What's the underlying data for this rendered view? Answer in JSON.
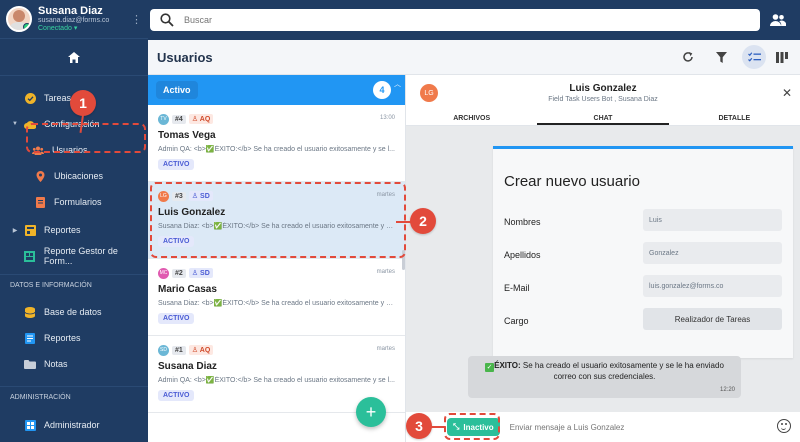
{
  "user": {
    "name": "Susana Diaz",
    "email": "susana.diaz@forms.co",
    "status": "Conectado"
  },
  "search": {
    "placeholder": "Buscar"
  },
  "sidebar": {
    "items": [
      {
        "label": "Tareas"
      },
      {
        "label": "Configuración"
      },
      {
        "label": "Usuarios"
      },
      {
        "label": "Ubicaciones"
      },
      {
        "label": "Formularios"
      },
      {
        "label": "Reportes"
      },
      {
        "label": "Reporte Gestor de Form..."
      }
    ],
    "section_data": "DATOS E INFORMACIÓN",
    "data_items": [
      {
        "label": "Base de datos"
      },
      {
        "label": "Reportes"
      },
      {
        "label": "Notas"
      }
    ],
    "section_admin": "ADMINISTRACIÓN",
    "admin_items": [
      {
        "label": "Administrador"
      }
    ]
  },
  "main": {
    "title": "Usuarios"
  },
  "list": {
    "status_label": "Activo",
    "count": "4",
    "cards": [
      {
        "initials": "TV",
        "number": "#4",
        "tag": "AQ",
        "time": "13:00",
        "name": "Tomas Vega",
        "snippet": "Admin QA: <b>✅ÉXITO:</b> Se ha creado el usuario exitosamente y se l...",
        "state": "ACTIVO"
      },
      {
        "initials": "LG",
        "number": "#3",
        "tag": "SD",
        "time": "martes",
        "name": "Luis Gonzalez",
        "snippet": "Susana Diaz: <b>✅ÉXITO:</b> Se ha creado el usuario exitosamente y se...",
        "state": "ACTIVO"
      },
      {
        "initials": "MC",
        "number": "#2",
        "tag": "SD",
        "time": "martes",
        "name": "Mario Casas",
        "snippet": "Susana Diaz: <b>✅ÉXITO:</b> Se ha creado el usuario exitosamente y se...",
        "state": "ACTIVO"
      },
      {
        "initials": "SD",
        "number": "#1",
        "tag": "AQ",
        "time": "martes",
        "name": "Susana Diaz",
        "snippet": "Admin QA: <b>✅ÉXITO:</b> Se ha creado el usuario exitosamente y se l...",
        "state": "ACTIVO"
      }
    ]
  },
  "chat": {
    "avatar_initials": "LG",
    "name": "Luis Gonzalez",
    "subtitle": "Field Task Users Bot , Susana Diaz",
    "tabs": [
      "ARCHIVOS",
      "CHAT",
      "DETALLE"
    ],
    "form": {
      "title": "Crear nuevo usuario",
      "fields": [
        {
          "label": "Nombres",
          "value": "Luis"
        },
        {
          "label": "Apellidos",
          "value": "Gonzalez"
        },
        {
          "label": "E-Mail",
          "value": "luis.gonzalez@forms.co"
        },
        {
          "label": "Cargo",
          "value": "Realizador de Tareas"
        }
      ]
    },
    "message": {
      "bold": "ÉXITO:",
      "text": "Se ha creado el usuario exitosamente y se le ha enviado correo con sus credenciales.",
      "time": "12:20"
    },
    "inactive_label": "Inactivo",
    "input_placeholder": "Enviar mensaje a Luis Gonzalez"
  },
  "annotations": [
    "1",
    "2",
    "3"
  ],
  "colors": {
    "sidebar": "#1f3c63",
    "accent": "#2196f3",
    "success": "#2bbf9a",
    "annotation": "#e24a3b"
  }
}
